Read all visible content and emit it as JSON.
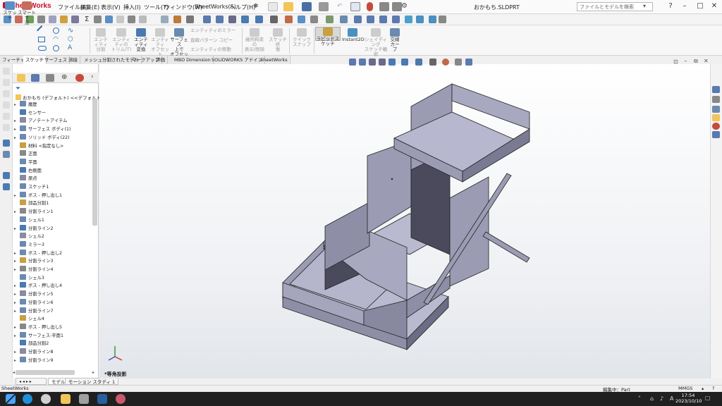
{
  "app": {
    "name": "SheetWorks",
    "document_title": "おかもち.SLDPRT"
  },
  "menu": [
    "ファイル(F)",
    "編集(E)",
    "表示(V)",
    "挿入(I)",
    "ツール(T)",
    "ウィンドウ(W)",
    "SheetWorks(S)",
    "ヘルプ(H)"
  ],
  "search": {
    "placeholder": "ファイルとモデルを検索"
  },
  "commands": [
    {
      "label": "スケッチ",
      "enabled": true
    },
    {
      "label": "スマートす\n法",
      "enabled": true
    },
    {
      "label": "エンティティ\n分割",
      "enabled": false
    },
    {
      "label": "エンティティの\nトリム(T)",
      "enabled": false
    },
    {
      "label": "エンティティ\n変換",
      "enabled": true
    },
    {
      "label": "エンティティ\nオフセット",
      "enabled": false
    },
    {
      "label": "サーフェス\n上で\nオフセット",
      "enabled": true
    },
    {
      "label": "エンティティのミラー",
      "enabled": false
    },
    {
      "label": "直線パターン コピー",
      "enabled": false
    },
    {
      "label": "エンティティの移動",
      "enabled": false
    },
    {
      "label": "幾何拘束の\n表示/削除",
      "enabled": false
    },
    {
      "label": "スケッチ修\n復",
      "enabled": false
    },
    {
      "label": "クイックスナップ",
      "enabled": false
    },
    {
      "label": "ラピッドスケッチ",
      "enabled": true
    },
    {
      "label": "Instant2D",
      "enabled": true
    },
    {
      "label": "シェイディング\nスケッチ輪\n郭",
      "enabled": false
    },
    {
      "label": "交線\nカーブ",
      "enabled": true
    }
  ],
  "cmd_tabs": [
    "フィーチャー",
    "スケッチ",
    "サーフェス",
    "溶接",
    "メッシュ分割されたモデル",
    "マークアップ",
    "評価",
    "MBD Dimension",
    "SOLIDWORKS アドイン",
    "SheetWorks"
  ],
  "active_cmd_tab": "スケッチ",
  "tree_root": "おかもち (デフォルト) <<デフォルト>_表示ス",
  "tree": [
    {
      "label": "履歴",
      "arrow": true
    },
    {
      "label": "センサー",
      "arrow": false
    },
    {
      "label": "アノテートアイテム",
      "arrow": true
    },
    {
      "label": "サーフェス ボディ(1)",
      "arrow": true
    },
    {
      "label": "ソリッド ボディ(22)",
      "arrow": true
    },
    {
      "label": "材料 <指定なし>",
      "arrow": false
    },
    {
      "label": "正面",
      "arrow": false
    },
    {
      "label": "平面",
      "arrow": false
    },
    {
      "label": "右側面",
      "arrow": false
    },
    {
      "label": "原点",
      "arrow": false
    },
    {
      "label": "スケッチ1",
      "arrow": false
    },
    {
      "label": "ボス - 押し出し1",
      "arrow": true
    },
    {
      "label": "部品分割1",
      "arrow": false
    },
    {
      "label": "分割ライン1",
      "arrow": true
    },
    {
      "label": "シェル1",
      "arrow": false
    },
    {
      "label": "分割ライン2",
      "arrow": true
    },
    {
      "label": "シェル2",
      "arrow": false
    },
    {
      "label": "ミラー3",
      "arrow": false
    },
    {
      "label": "ボス - 押し出し2",
      "arrow": true
    },
    {
      "label": "分割ライン3",
      "arrow": true
    },
    {
      "label": "分割ライン4",
      "arrow": true
    },
    {
      "label": "シェル3",
      "arrow": false
    },
    {
      "label": "ボス - 押し出し4",
      "arrow": true
    },
    {
      "label": "分割ライン5",
      "arrow": true
    },
    {
      "label": "分割ライン6",
      "arrow": true
    },
    {
      "label": "分割ライン7",
      "arrow": true
    },
    {
      "label": "シェル4",
      "arrow": false
    },
    {
      "label": "ボス - 押し出し5",
      "arrow": true
    },
    {
      "label": "サーフェス-平面1",
      "arrow": true
    },
    {
      "label": "部品分割2",
      "arrow": false
    },
    {
      "label": "分割ライン8",
      "arrow": true
    },
    {
      "label": "分割ライン9",
      "arrow": true
    }
  ],
  "bottom_tabs": [
    "モデル",
    "モーション スタディ 1"
  ],
  "view_label": "*等角投影",
  "status": {
    "left": "SheetWorks",
    "editing": "編集中：Part",
    "units": "MMGS"
  },
  "clock": {
    "time": "17:54",
    "date": "2023/10/10"
  },
  "colors": {
    "brand": "#c8102e",
    "model_face": "#9b9bb4",
    "model_dark": "#4a4a5c",
    "model_top": "#b7b7cf"
  }
}
